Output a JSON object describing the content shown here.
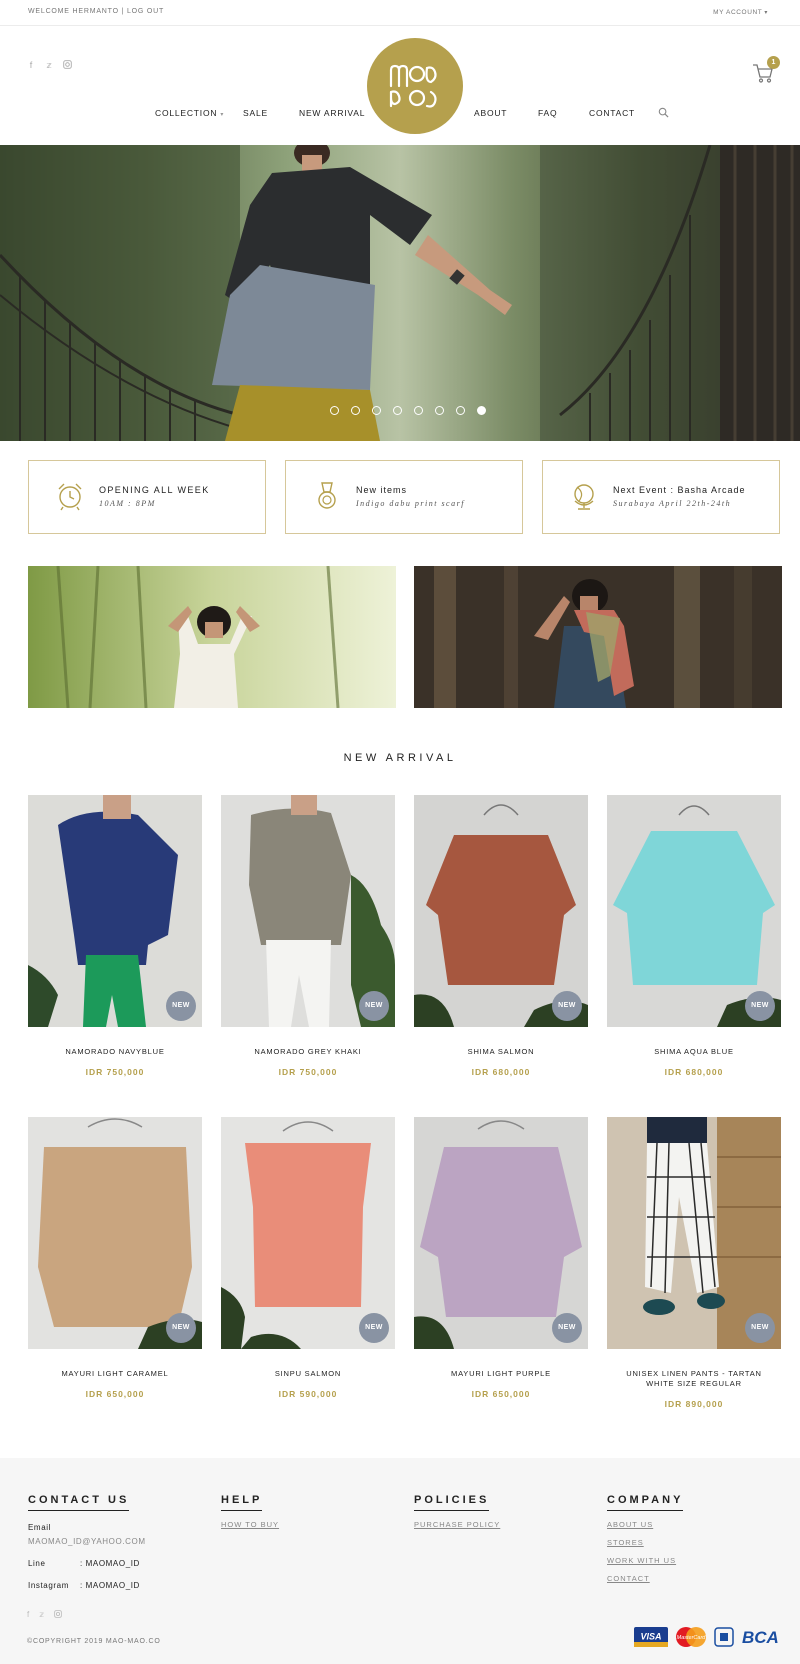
{
  "topbar": {
    "welcome": "WELCOME HERMANTO",
    "separator": "|",
    "logout": "LOG OUT",
    "account": "MY ACCOUNT"
  },
  "header": {
    "cart_count": "1",
    "brand_color": "#b5a04d"
  },
  "nav": {
    "collection": "COLLECTION",
    "sale": "SALE",
    "new_arrival": "NEW ARRIVAL",
    "about": "ABOUT",
    "faq": "FAQ",
    "contact": "CONTACT"
  },
  "hero": {
    "slides": 8,
    "active_slide": 8
  },
  "info": [
    {
      "title": "OPENING ALL WEEK",
      "subtitle": "10AM : 8PM",
      "icon": "alarm-clock-icon"
    },
    {
      "title": "New items",
      "subtitle": "Indigo dabu print scarf",
      "icon": "medal-icon"
    },
    {
      "title": "Next Event : Basha Arcade",
      "subtitle": "Surabaya April 22th-24th",
      "icon": "globe-icon"
    }
  ],
  "section_title": "NEW ARRIVAL",
  "badge": "NEW",
  "products": [
    {
      "name": "NAMORADO NAVYBLUE",
      "price": "IDR 750,000"
    },
    {
      "name": "NAMORADO GREY KHAKI",
      "price": "IDR 750,000"
    },
    {
      "name": "SHIMA SALMON",
      "price": "IDR 680,000"
    },
    {
      "name": "SHIMA AQUA BLUE",
      "price": "IDR 680,000"
    },
    {
      "name": "MAYURI LIGHT CARAMEL",
      "price": "IDR 650,000"
    },
    {
      "name": "SINPU SALMON",
      "price": "IDR 590,000"
    },
    {
      "name": "MAYURI LIGHT PURPLE",
      "price": "IDR 650,000"
    },
    {
      "name": "UNISEX LINEN PANTS - TARTAN WHITE SIZE REGULAR",
      "price": "IDR 890,000"
    }
  ],
  "footer": {
    "contact_title": "CONTACT US",
    "email_label": "Email",
    "email": "MAOMAO_ID@YAHOO.COM",
    "line_label": "Line",
    "line": ": MAOMAO_ID",
    "instagram_label": "Instagram",
    "instagram": ": MAOMAO_ID",
    "help_title": "HELP",
    "help_links": [
      "HOW TO BUY"
    ],
    "policies_title": "POLICIES",
    "policies_links": [
      "PURCHASE POLICY"
    ],
    "company_title": "COMPANY",
    "company_links": [
      "ABOUT US",
      "STORES",
      "WORK WITH US",
      "CONTACT"
    ],
    "copyright": "©COPYRIGHT 2019 MAO-MAO.CO",
    "payments": [
      "VISA",
      "MasterCard",
      "BCA"
    ]
  }
}
